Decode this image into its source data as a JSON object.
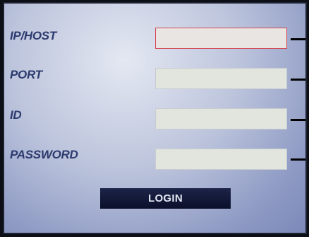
{
  "form": {
    "ip_host": {
      "label": "IP/HOST",
      "value": ""
    },
    "port": {
      "label": "PORT",
      "value": ""
    },
    "id": {
      "label": "ID",
      "value": ""
    },
    "password": {
      "label": "PASSWORD",
      "value": ""
    }
  },
  "login_button": {
    "label": "LOGIN"
  },
  "colors": {
    "label_text": "#2c3a6e",
    "field_bg": "#e2e4de",
    "focused_border": "#d44a55",
    "button_bg": "#0a0f2a",
    "button_text": "#e4e8f4"
  }
}
